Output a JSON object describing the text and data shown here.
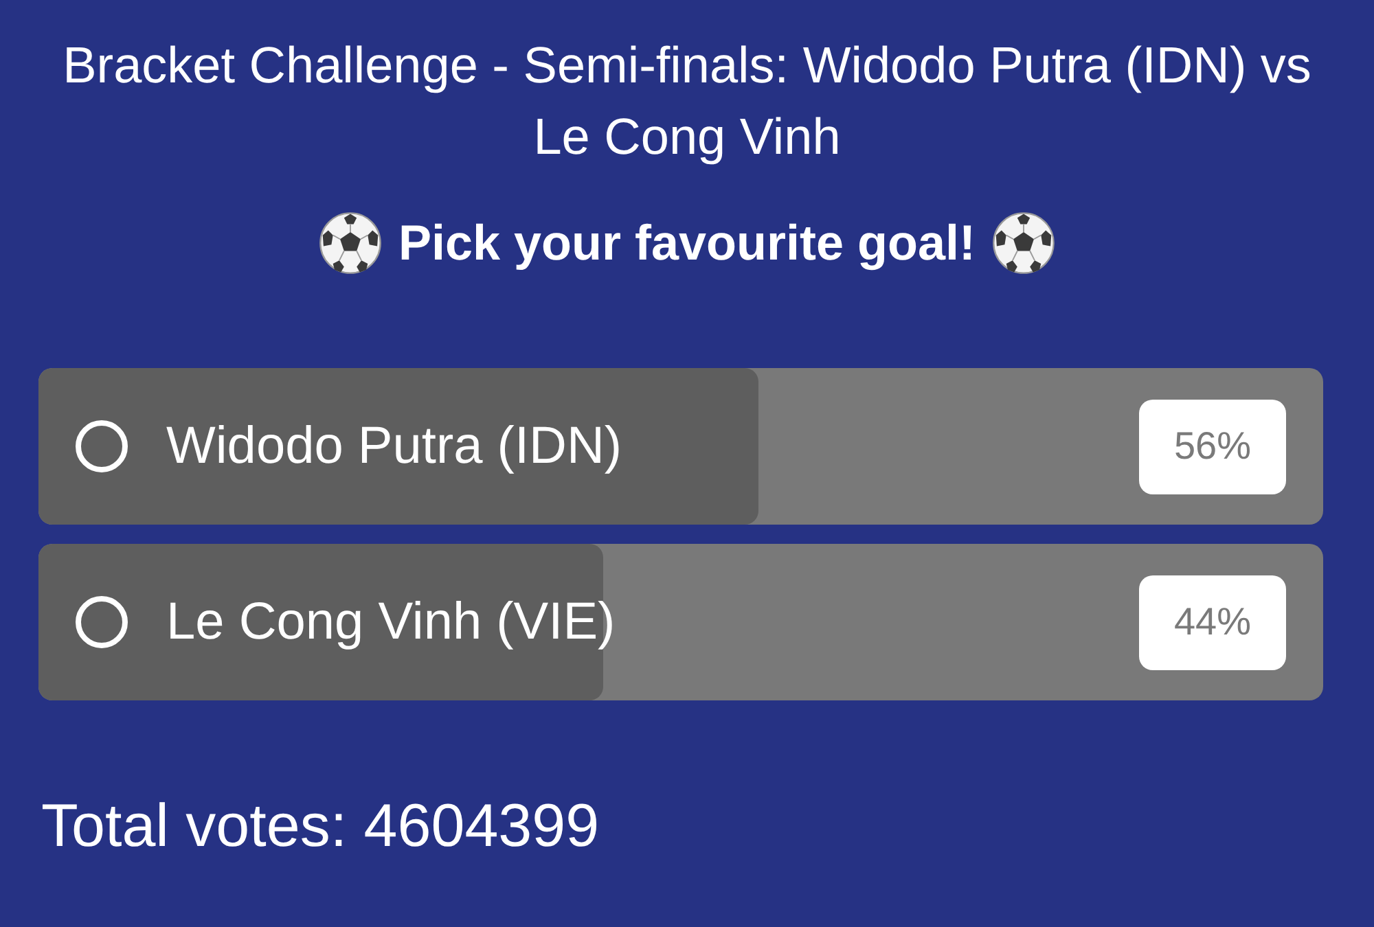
{
  "poll": {
    "title": "Bracket Challenge - Semi-finals: Widodo Putra (IDN) vs Le Cong Vinh",
    "prompt": "Pick your favourite goal!",
    "options": [
      {
        "label": "Widodo Putra (IDN)",
        "selected": false,
        "level": 0.56,
        "percent": "56%"
      },
      {
        "label": "Le Cong Vinh (VIE)",
        "selected": false,
        "level": 0.44,
        "percent": "44%"
      }
    ],
    "total_votes": "Total votes: 4604399"
  }
}
